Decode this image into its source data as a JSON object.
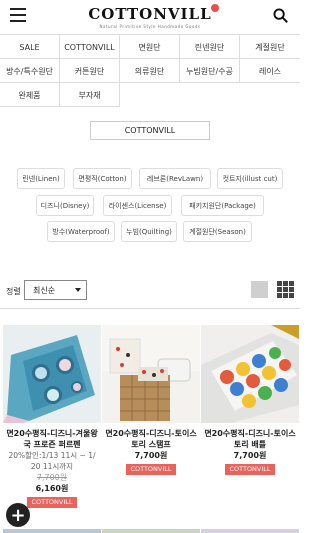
{
  "header": {
    "logo_text": "COTTONVILL",
    "logo_sub": "Natural Primitive Style Handmade Goods"
  },
  "categories": [
    [
      "SALE",
      "COTTONVILL",
      "면원단",
      "린넨원단",
      "계절원단"
    ],
    [
      "방수/특수원단",
      "커튼원단",
      "의류원단",
      "누빔원단/수공",
      "레이스"
    ],
    [
      "완제품",
      "부자재"
    ]
  ],
  "brand_box": "COTTONVILL",
  "tags": {
    "linen": "린넨(Linen)",
    "cotton": "면평직(Cotton)",
    "revlawn": "레브론(RevLawn)",
    "illust": "컷트지(illust cut)",
    "disney": "디즈니(Disney)",
    "license": "라이센스(License)",
    "package": "패키지원단(Package)",
    "waterproof": "방수(Waterproof)",
    "quilting": "누빔(Quilting)",
    "season": "계절원단(Season)"
  },
  "sort": {
    "label": "정렬",
    "selected": "최신순"
  },
  "products": [
    {
      "name_line1": "면20수평직-디즈니-겨울왕",
      "name_line2": "국 프로즌 퍼르펜",
      "discount_line1": "20%할인:1/13 11시 ~ 1/",
      "discount_line2": "20 11시까지",
      "old_price": "7,700원",
      "price": "6,160원",
      "badge": "COTTONVILL"
    },
    {
      "name_line1": "면20수평직-디즈니-토이스",
      "name_line2": "토리 스탬프",
      "price": "7,700원",
      "badge": "COTTONVILL"
    },
    {
      "name_line1": "면20수평직-디즈니-토이스",
      "name_line2": "토리 배틀",
      "price": "7,700원",
      "badge": "COTTONVILL"
    }
  ],
  "colors": {
    "badge": "#e9635d",
    "logo_dot": "#e8504a",
    "border": "#dddddd"
  }
}
